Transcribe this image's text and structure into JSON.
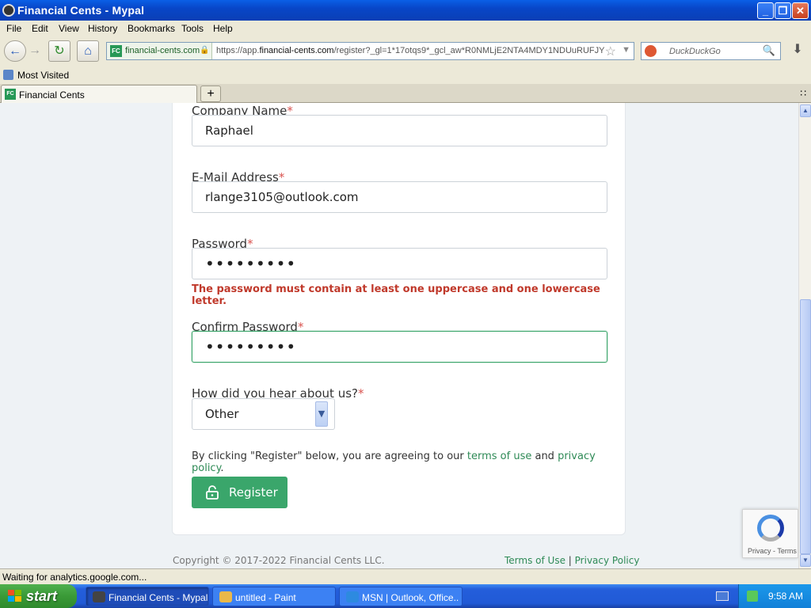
{
  "window": {
    "title": "Financial Cents - Mypal",
    "minimize": "_",
    "maximize": "❐",
    "close": "✕"
  },
  "menu": [
    "File",
    "Edit",
    "View",
    "History",
    "Bookmarks",
    "Tools",
    "Help"
  ],
  "nav": {
    "site_identity": "financial-cents.com",
    "site_badge": "FC",
    "url_prefix": "https://app.",
    "url_domain": "financial-cents.com",
    "url_rest": "/register?_gl=1*17otqs9*_gcl_aw*R0NMLjE2NTA4MDY1NDUuRUFJYU",
    "search_placeholder": "DuckDuckGo"
  },
  "bookmarks": {
    "most_visited": "Most Visited"
  },
  "tabs": [
    {
      "label": "Financial Cents",
      "badge": "FC"
    }
  ],
  "form": {
    "company_label": "Company Name",
    "company_value": "Raphael",
    "email_label": "E-Mail Address",
    "email_value": "rlange3105@outlook.com",
    "password_label": "Password",
    "password_value": "•••••••••",
    "password_error": "The password must contain at least one uppercase and one lowercase letter.",
    "confirm_label": "Confirm Password",
    "confirm_value": "•••••••••",
    "source_label": "How did you hear about us?",
    "source_value": "Other",
    "required_mark": "*",
    "agree_prefix": "By clicking \"Register\" below, you are agreeing to our ",
    "terms_link": "terms of use",
    "agree_and": " and ",
    "privacy_link": "privacy policy",
    "agree_suffix": ".",
    "register_label": "Register"
  },
  "footer": {
    "copyright": "Copyright © 2017-2022 Financial Cents LLC.",
    "terms": "Terms of Use",
    "separator": "|",
    "privacy": "Privacy Policy"
  },
  "recaptcha": {
    "text": "Privacy - Terms"
  },
  "status": {
    "text": "Waiting for analytics.google.com..."
  },
  "taskbar": {
    "start": "start",
    "items": [
      {
        "label": "Financial Cents - Mypal"
      },
      {
        "label": "untitled - Paint"
      },
      {
        "label": "MSN | Outlook, Office..."
      }
    ],
    "clock": "9:58 AM"
  }
}
